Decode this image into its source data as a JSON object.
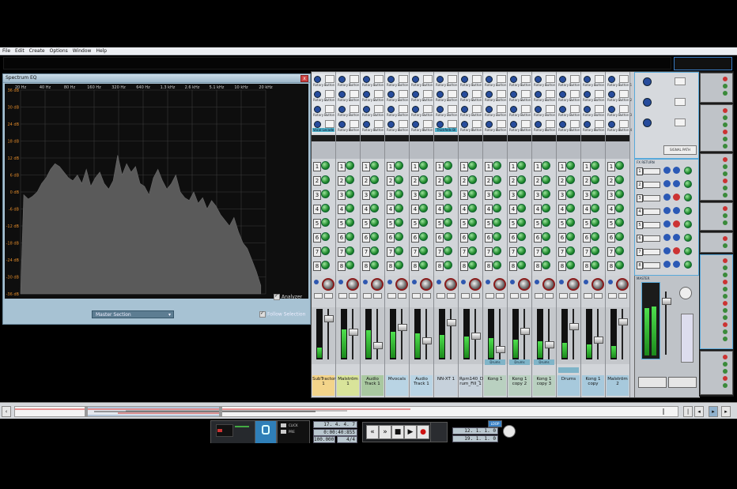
{
  "menu": [
    "File",
    "Edit",
    "Create",
    "Options",
    "Window",
    "Help"
  ],
  "eq": {
    "title": "Spectrum EQ",
    "close_label": "x",
    "freq_labels": [
      "20 Hz",
      "40 Hz",
      "80 Hz",
      "160 Hz",
      "320 Hz",
      "640 Hz",
      "1.3 kHz",
      "2.6 kHz",
      "5.1 kHz",
      "10 kHz",
      "20 kHz"
    ],
    "db_labels": [
      "36 dB",
      "30 dB",
      "24 dB",
      "18 dB",
      "12 dB",
      "6 dB",
      "0 dB",
      "-6 dB",
      "-12 dB",
      "-18 dB",
      "-24 dB",
      "-30 dB",
      "-36 dB"
    ],
    "analyzer_label": "Analyzer",
    "section_select": "Master Section",
    "follow_label": "Follow Selection",
    "spectrum_levels": [
      -1,
      -2.5,
      -1.5,
      0,
      3,
      5,
      8,
      10,
      9,
      7,
      5,
      4,
      6,
      3,
      8,
      2,
      5,
      7,
      3,
      1,
      4,
      13,
      6,
      10,
      7,
      9,
      3,
      2,
      -1,
      5,
      8,
      4,
      1,
      3,
      6,
      0,
      -2,
      -3,
      0,
      -4,
      -2,
      -6,
      -3,
      -5,
      -8,
      -10,
      -12,
      -9,
      -14,
      -18,
      -20,
      -24,
      -28,
      -33
    ]
  },
  "mixer": {
    "device_labels": {
      "button": "Button",
      "rotary": "Rotary"
    },
    "insert_tags": [
      "Vocal Lecade",
      "",
      "",
      "",
      "",
      "Thickfeds Bl",
      "",
      "",
      "",
      "",
      "",
      "",
      ""
    ],
    "channels": [
      {
        "name": "SubTractor 1",
        "color": "#f3d48a"
      },
      {
        "name": "Malström 1",
        "color": "#d9e49a"
      },
      {
        "name": "Audio Track 1",
        "color": "#a9c8a0"
      },
      {
        "name": "Mvocals",
        "color": "#b9d4e4"
      },
      {
        "name": "Audio Track 1",
        "color": "#b9d4e4"
      },
      {
        "name": "NN-XT 1",
        "color": "#c6d1db"
      },
      {
        "name": "Rpm140_D rum_Fill_1",
        "color": "#c6d1db"
      },
      {
        "name": "Kong 1",
        "color": "#b9d0c0"
      },
      {
        "name": "Kong 1 copy 2",
        "color": "#b9d0c0"
      },
      {
        "name": "Kong 1 copy 3",
        "color": "#b9d0c0"
      },
      {
        "name": "Drums",
        "color": "#a7c9dc"
      },
      {
        "name": "Kong 1 copy",
        "color": "#a7c9dc"
      },
      {
        "name": "Malström 2",
        "color": "#a7c9dc"
      }
    ],
    "group_tags": [
      "Drums",
      "Drums",
      "Drums"
    ],
    "fx_return_numbers": [
      "1",
      "2",
      "3",
      "4",
      "5",
      "6",
      "7",
      "8"
    ],
    "fx_returns_title": "FX RETURN",
    "master_label": "MASTER",
    "signal_path": "SIGNAL PATH"
  },
  "transport": {
    "position": "17. 4. 4. 7",
    "time": "0:00:40:855",
    "tempo": "100.000",
    "signature": "4/4",
    "loop_left": "12. 1. 1. 0",
    "loop_right": "19. 1. 1. 0",
    "loop_label": "LOOP",
    "click_label": "CLICK",
    "pre_label": "PRE"
  }
}
